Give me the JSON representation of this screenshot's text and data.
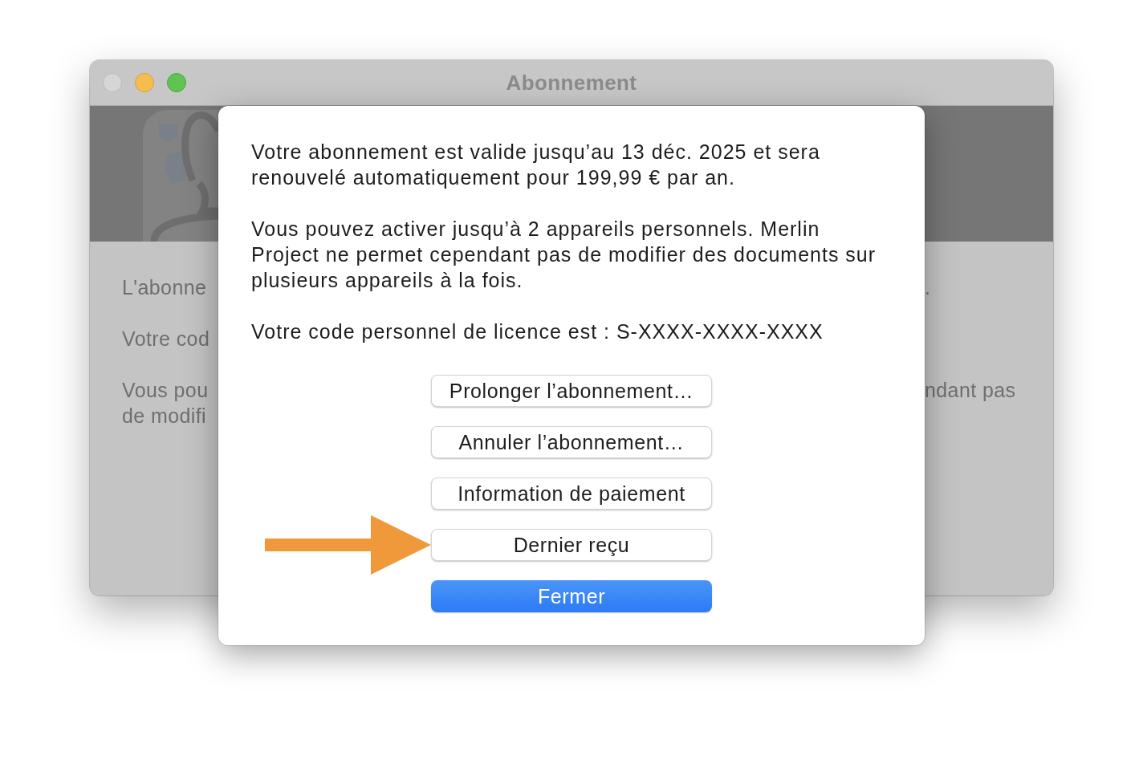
{
  "window": {
    "title": "Abonnement",
    "controls": [
      {
        "kind": "close",
        "disabled": true
      },
      {
        "kind": "minimize",
        "disabled": false
      },
      {
        "kind": "zoom",
        "disabled": false
      }
    ]
  },
  "background": {
    "paragraphs": [
      {
        "left": [
          "L'abonne"
        ],
        "right": [
          "."
        ]
      },
      {
        "left": [
          "Votre cod"
        ]
      },
      {
        "left": [
          "Vous pou",
          "de modifi"
        ],
        "right": [
          "ndant pas"
        ]
      }
    ]
  },
  "dialog": {
    "paragraphs": [
      "Votre abonnement est valide jusqu’au 13 déc. 2025 et sera renouvelé automatiquement pour 199,99 € par an.",
      "Vous pouvez activer jusqu’à 2 appareils personnels. Merlin Project ne permet cependant pas de modifier des documents sur plusieurs appareils à la fois.",
      "Votre code personnel de licence est : S-XXXX-XXXX-XXXX"
    ],
    "buttons": [
      {
        "label": "Prolonger l’abonnement…",
        "kind": "default",
        "highlighted": false
      },
      {
        "label": "Annuler l’abonnement…",
        "kind": "default",
        "highlighted": false
      },
      {
        "label": "Information de paiement",
        "kind": "default",
        "highlighted": false
      },
      {
        "label": "Dernier reçu",
        "kind": "default",
        "highlighted": true
      },
      {
        "label": "Fermer",
        "kind": "primary",
        "highlighted": false
      }
    ]
  }
}
